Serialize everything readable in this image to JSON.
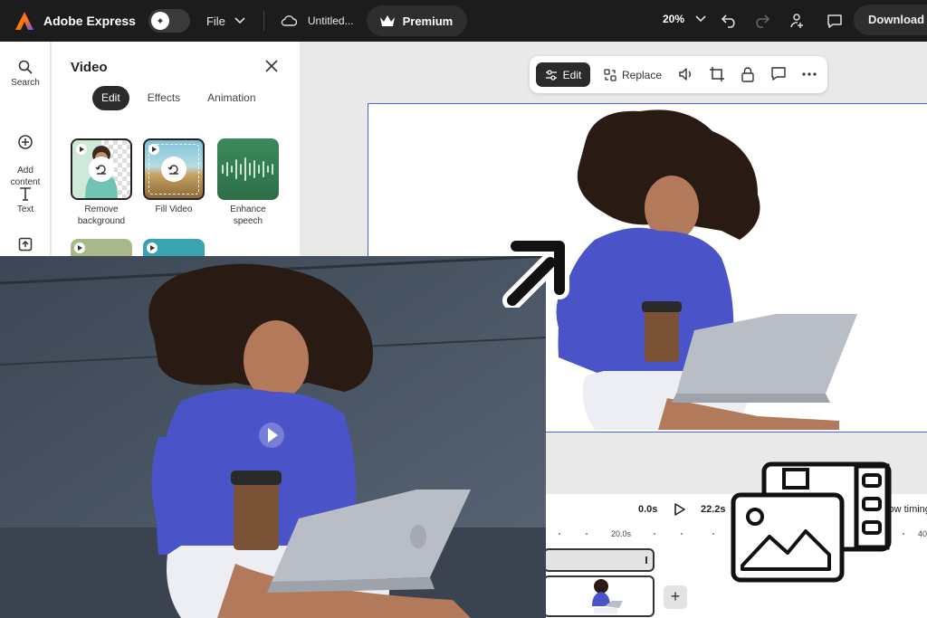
{
  "app": {
    "brand": "Adobe Express",
    "file_menu": "File",
    "doc_title": "Untitled...",
    "premium_label": "Premium",
    "zoom": "20%",
    "download_label": "Download"
  },
  "rail": {
    "items": [
      {
        "label": "Search",
        "icon": "search-icon"
      },
      {
        "label": "Add\ncontent",
        "icon": "plus-circle-icon"
      },
      {
        "label": "Text",
        "icon": "text-icon"
      },
      {
        "label": "",
        "icon": "upload-icon"
      }
    ]
  },
  "panel": {
    "title": "Video",
    "tabs": [
      "Edit",
      "Effects",
      "Animation"
    ],
    "active_tab": "Edit",
    "tiles": [
      {
        "label": "Remove\nbackground"
      },
      {
        "label": "Fill Video"
      },
      {
        "label": "Enhance\nspeech"
      }
    ]
  },
  "float_toolbar": {
    "edit_label": "Edit",
    "replace_label": "Replace"
  },
  "timeline": {
    "start_time": "0.0s",
    "end_time": "22.2s",
    "ruler_20": "20.0s",
    "ruler_40": "40",
    "show_timing": "Show timing"
  },
  "colors": {
    "accent": "#4a63e6",
    "topbar": "#1c1c1c",
    "dress": "#4a53c7"
  }
}
